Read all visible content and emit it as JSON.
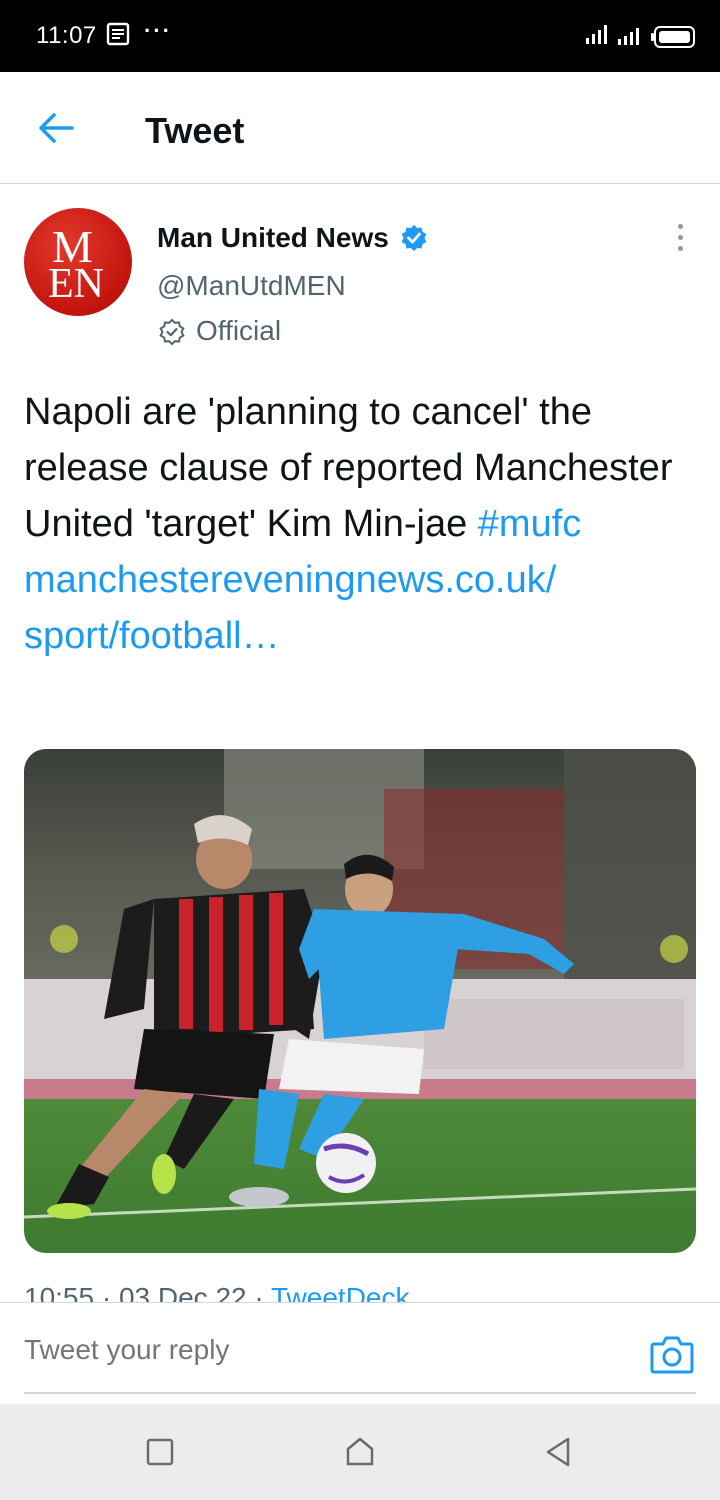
{
  "status_bar": {
    "time": "11:07",
    "more": "···",
    "icons": [
      "notification-icon",
      "signal-icon",
      "wifi-icon",
      "battery-icon"
    ]
  },
  "header": {
    "title": "Tweet",
    "back_icon": "arrow-left-icon"
  },
  "tweet": {
    "author": {
      "avatar_letters": {
        "top": "M",
        "bottom": "EN"
      },
      "name": "Man United News",
      "handle": "@ManUtdMEN",
      "label": "Official",
      "verified": true
    },
    "text": {
      "body": "Napoli are 'planning to cancel' the release clause of reported Manchester United 'target' Kim Min-jae",
      "hashtag": "#mufc",
      "url_line1": "manchestereveningnews.co.uk/",
      "url_line2": "sport/football…"
    },
    "meta": {
      "time": "10:55",
      "sep1": " · ",
      "date": "03 Dec 22",
      "sep2": " · ",
      "source": "TweetDeck"
    }
  },
  "reply": {
    "placeholder": "Tweet your reply",
    "camera_icon": "camera-icon"
  },
  "nav_bar": {
    "icons": [
      "recents-square-icon",
      "home-icon",
      "back-triangle-icon"
    ]
  },
  "colors": {
    "accent": "#1d9bf0",
    "text_primary": "#0f1419",
    "text_secondary": "#536471",
    "avatar_red": "#c2140d"
  }
}
